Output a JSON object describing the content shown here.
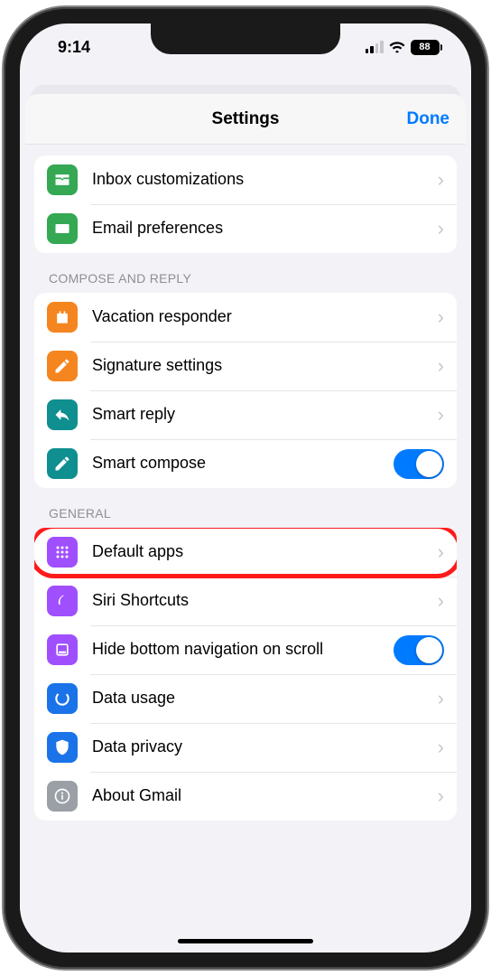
{
  "status": {
    "time": "9:14",
    "battery": "88"
  },
  "header": {
    "title": "Settings",
    "done": "Done"
  },
  "section0": {
    "items": [
      {
        "label": "Inbox customizations"
      },
      {
        "label": "Email preferences"
      }
    ]
  },
  "sections": [
    {
      "label": "COMPOSE AND REPLY",
      "items": [
        {
          "label": "Vacation responder"
        },
        {
          "label": "Signature settings"
        },
        {
          "label": "Smart reply"
        },
        {
          "label": "Smart compose"
        }
      ]
    },
    {
      "label": "GENERAL",
      "items": [
        {
          "label": "Default apps"
        },
        {
          "label": "Siri Shortcuts"
        },
        {
          "label": "Hide bottom navigation on scroll"
        },
        {
          "label": "Data usage"
        },
        {
          "label": "Data privacy"
        },
        {
          "label": "About Gmail"
        }
      ]
    }
  ]
}
